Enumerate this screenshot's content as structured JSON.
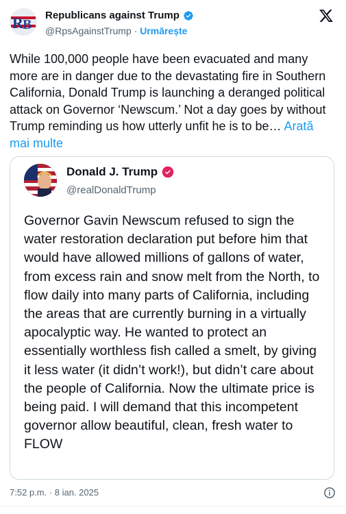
{
  "author": {
    "display_name": "Republicans against Trump",
    "handle": "@RpsAgainstTrump",
    "separator": "·",
    "follow_label": "Urmărește",
    "avatar_monogram": "RB",
    "avatar_icon": "rb-logo",
    "verified_icon": "verified-badge-icon",
    "platform_icon": "x-logo-icon"
  },
  "tweet": {
    "text": "While 100,000 people have been evacuated and many more are in danger due to the devastating fire in Southern California, Donald Trump is launching a deranged political attack on Governor ‘Newscum.’ Not a day goes by without Trump reminding us how utterly unfit he is to be…",
    "show_more_label": "Arată mai multe"
  },
  "quoted": {
    "display_name": "Donald J. Trump",
    "handle": "@realDonaldTrump",
    "badge_icon": "affiliation-badge-icon",
    "text": "Governor Gavin Newscum refused to sign the water restoration declaration put before him that would have allowed millions of gallons of water, from excess rain and snow melt from the North, to flow daily into many parts of California, including the areas that are currently burning in a virtually apocalyptic way. He wanted to protect an essentially worthless fish called a smelt, by giving it less water (it didn’t work!), but didn’t care about the people of California. Now the ultimate price is being paid. I will demand that this incompetent governor allow beautiful, clean, fresh water to FLOW"
  },
  "footer": {
    "timestamp": "7:52 p.m. · 8 ian. 2025",
    "info_icon": "info-icon"
  },
  "colors": {
    "text": "#0f1419",
    "secondary": "#536471",
    "link": "#1d9bf0",
    "border": "#cfd9de",
    "badge_pink": "#e0245e"
  }
}
